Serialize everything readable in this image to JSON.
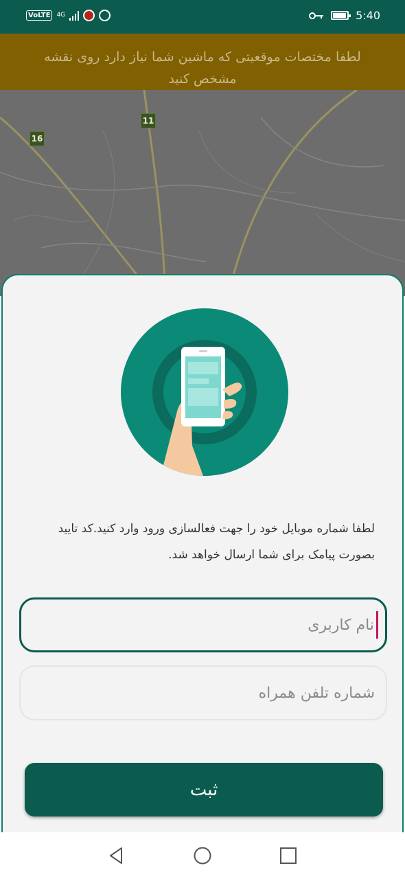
{
  "status_bar": {
    "volte": "VoLTE",
    "network": "4G",
    "time": "5:40",
    "icons": [
      "volte-icon",
      "signal-icon",
      "app-notification-icon",
      "android-icon",
      "vpn-key-icon",
      "battery-icon"
    ]
  },
  "banner": {
    "text": "لطفا مختصات موقعیتی که ماشین شما نیاز دارد روی نقشه مشخص کنید"
  },
  "map": {
    "road_labels": [
      "16",
      "11"
    ]
  },
  "sheet": {
    "illustration_icon": "phone-in-hand-icon",
    "instructions": "لطفا شماره موبایل خود را جهت فعالسازی ورود وارد کنید.کد تایید بصورت پیامک برای شما ارسال خواهد شد.",
    "username": {
      "value": "",
      "placeholder": "نام کاربری"
    },
    "phone": {
      "value": "",
      "placeholder": "شماره تلفن همراه"
    },
    "submit_label": "ثبت"
  },
  "nav_bar": {
    "icons": [
      "back-icon",
      "home-icon",
      "recents-icon"
    ]
  },
  "colors": {
    "primary": "#0b5c4e",
    "accent_circle": "#0b8a77",
    "banner": "#806000",
    "caret": "#c2185b"
  }
}
